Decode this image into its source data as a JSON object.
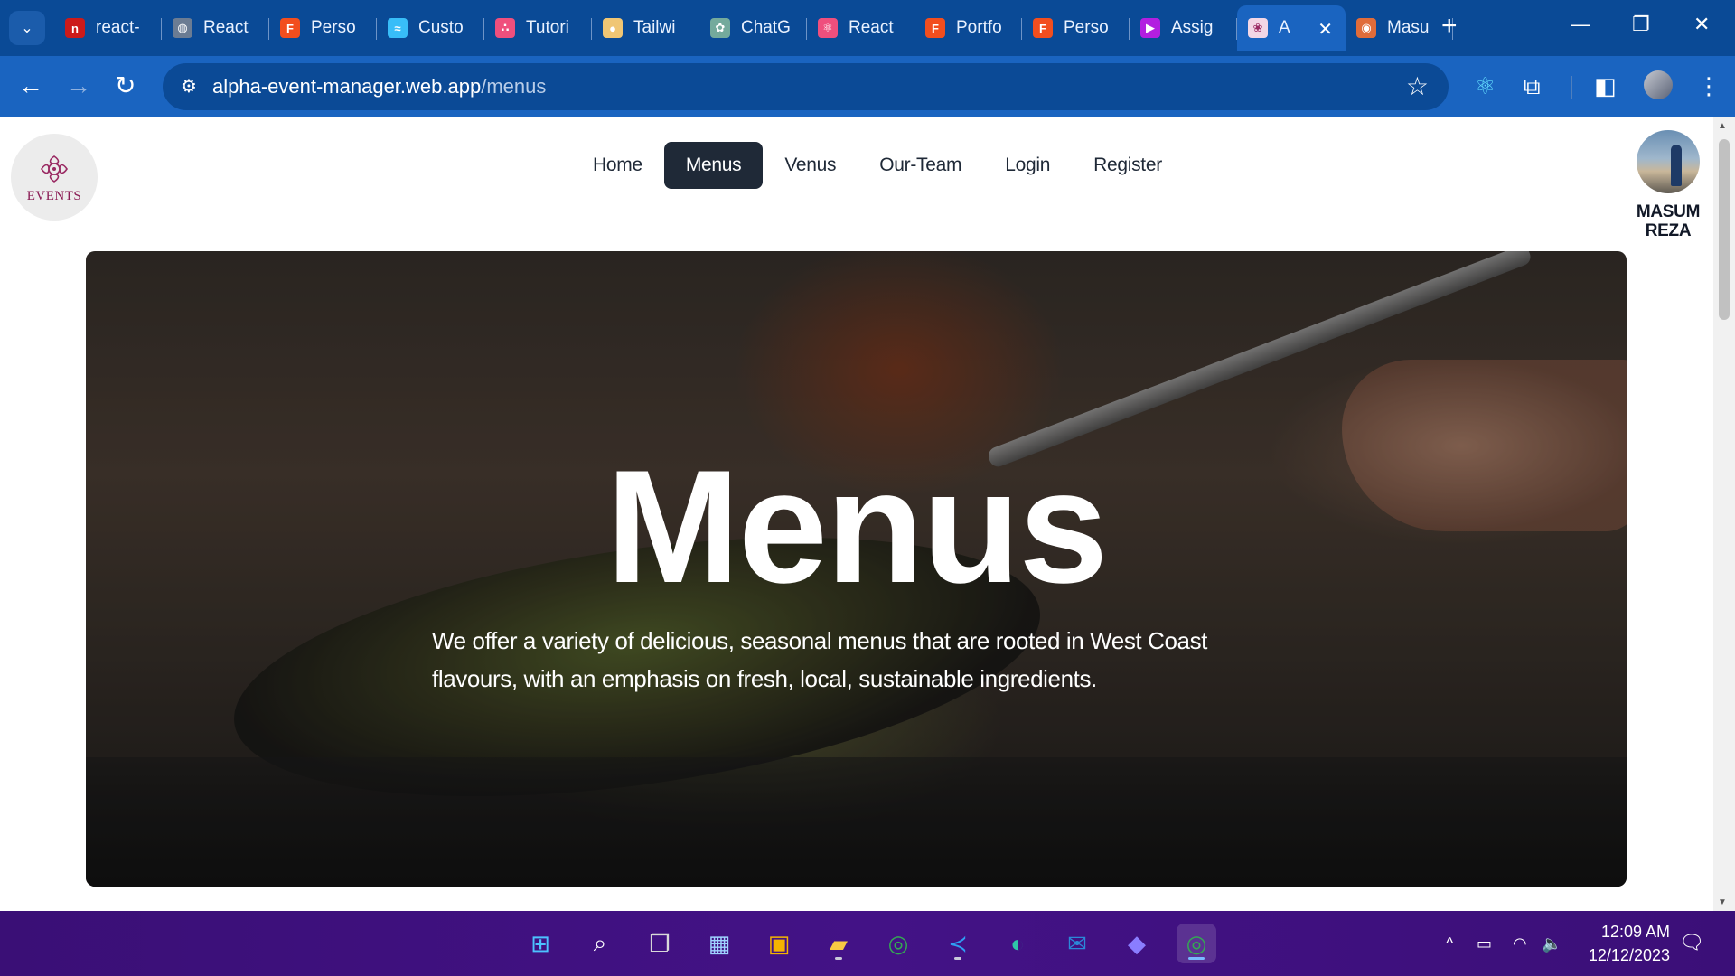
{
  "browser": {
    "tabs": [
      {
        "title": "react-",
        "icon": "n-icon",
        "color": "#cc1a1a",
        "glyph": "n",
        "active": false
      },
      {
        "title": "React",
        "icon": "globe-icon",
        "color": "#6b7c93",
        "glyph": "◍",
        "active": false
      },
      {
        "title": "Perso",
        "icon": "figma-icon",
        "color": "#f24e1e",
        "glyph": "F",
        "active": false
      },
      {
        "title": "Custo",
        "icon": "tailwind-icon",
        "color": "#38bdf8",
        "glyph": "≈",
        "active": false
      },
      {
        "title": "Tutori",
        "icon": "nodes-icon",
        "color": "#ef4f7d",
        "glyph": "∴",
        "active": false
      },
      {
        "title": "Tailwi",
        "icon": "pin-icon",
        "color": "#f0c674",
        "glyph": "●",
        "active": false
      },
      {
        "title": "ChatG",
        "icon": "chatgpt-icon",
        "color": "#74aa9c",
        "glyph": "✿",
        "active": false
      },
      {
        "title": "React",
        "icon": "react-icon",
        "color": "#ef4f7d",
        "glyph": "⚛",
        "active": false
      },
      {
        "title": "Portfo",
        "icon": "figma-icon",
        "color": "#f24e1e",
        "glyph": "F",
        "active": false
      },
      {
        "title": "Perso",
        "icon": "figma-icon",
        "color": "#f24e1e",
        "glyph": "F",
        "active": false
      },
      {
        "title": "Assig",
        "icon": "play-icon",
        "color": "#b21fe0",
        "glyph": "▶",
        "active": false
      },
      {
        "title": "A",
        "icon": "events-favicon-icon",
        "color": "#f3d7e6",
        "glyph": "❀",
        "active": true
      },
      {
        "title": "Masu",
        "icon": "avatar-favicon-icon",
        "color": "#e06c3a",
        "glyph": "◉",
        "active": false
      }
    ],
    "new_tab": "+",
    "window": {
      "minimize": "—",
      "restore": "❐",
      "close": "✕"
    },
    "tab_close": "✕",
    "url_host": "alpha-event-manager.web.app",
    "url_path": "/menus",
    "back": "←",
    "forward": "→",
    "reload": "↻",
    "star": "☆",
    "site_info": "⚙",
    "ext_react": "⚛",
    "ext_puzzle": "⧉",
    "side_panel": "◧",
    "menu": "⋮",
    "tab_search": "⌄"
  },
  "site": {
    "logo_text": "EVENTS",
    "nav": [
      {
        "label": "Home",
        "active": false
      },
      {
        "label": "Menus",
        "active": true
      },
      {
        "label": "Venus",
        "active": false
      },
      {
        "label": "Our-Team",
        "active": false
      },
      {
        "label": "Login",
        "active": false
      },
      {
        "label": "Register",
        "active": false
      }
    ],
    "user": {
      "first": "MASUM",
      "last": "REZA"
    }
  },
  "hero": {
    "title": "Menus",
    "description": "We offer a variety of delicious, seasonal menus that are rooted in West Coast flavours, with an emphasis on fresh, local, sustainable ingredients."
  },
  "taskbar": {
    "apps": [
      {
        "name": "start-button",
        "glyph": "⊞",
        "color": "#4cc2ff",
        "running": false
      },
      {
        "name": "search-button",
        "glyph": "⌕",
        "color": "#ffffff",
        "running": false
      },
      {
        "name": "task-view-button",
        "glyph": "❐",
        "color": "#d9d9d9",
        "running": false
      },
      {
        "name": "widgets-button",
        "glyph": "▦",
        "color": "#9fd3ff",
        "running": false
      },
      {
        "name": "store-app",
        "glyph": "▣",
        "color": "#f5b400",
        "running": false
      },
      {
        "name": "file-explorer-app",
        "glyph": "▰",
        "color": "#f8c943",
        "running": true
      },
      {
        "name": "chrome-app",
        "glyph": "◎",
        "color": "#34a853",
        "running": false
      },
      {
        "name": "vscode-app",
        "glyph": "≺",
        "color": "#2f9ef4",
        "running": true
      },
      {
        "name": "edge-app",
        "glyph": "◐",
        "color": "#2fc6a8",
        "running": false
      },
      {
        "name": "mail-app",
        "glyph": "✉",
        "color": "#2b88d8",
        "running": false
      },
      {
        "name": "copilot-app",
        "glyph": "◆",
        "color": "#8a7dff",
        "running": false
      },
      {
        "name": "chrome-active-app",
        "glyph": "◎",
        "color": "#34a853",
        "running": true,
        "active": true
      }
    ],
    "tray": {
      "chevron": "^",
      "battery": "▭",
      "wifi": "◠",
      "volume": "🔈"
    },
    "time": "12:09 AM",
    "date": "12/12/2023",
    "notification": "🗨"
  }
}
